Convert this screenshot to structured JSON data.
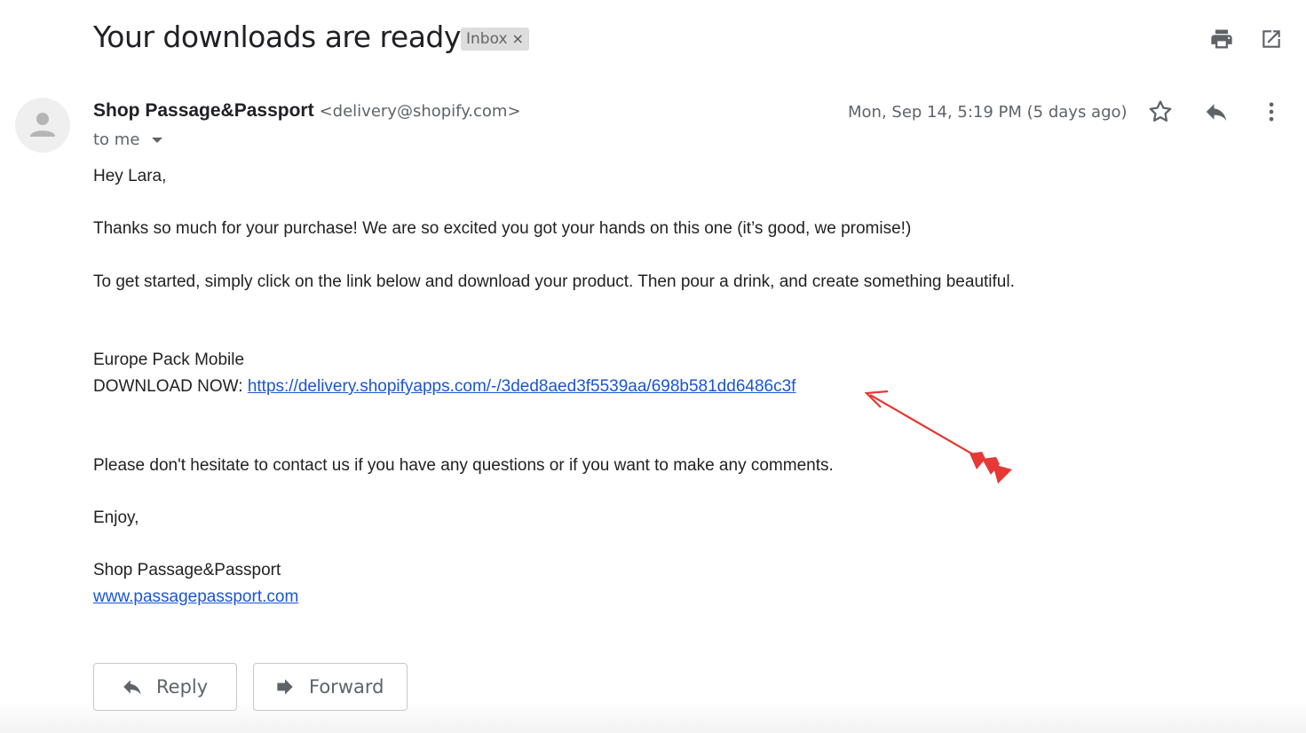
{
  "email": {
    "subject": "Your downloads are ready",
    "label": "Inbox",
    "label_close": "×",
    "sender_name": "Shop Passage&Passport",
    "sender_email": "<delivery@shopify.com>",
    "recipient": "to me",
    "date": "Mon, Sep 14, 5:19 PM (5 days ago)"
  },
  "body": {
    "greeting": "Hey Lara,",
    "para1": "Thanks so much for your purchase! We are so excited you got your hands on this one (it’s good, we promise!)",
    "para2": "To get started, simply click on the link below and download your product. Then pour a drink, and create something beautiful.",
    "product_name": "Europe Pack Mobile",
    "download_label": "DOWNLOAD NOW:",
    "download_link": "https://delivery.shopifyapps.com/-/3ded8aed3f5539aa/698b581dd6486c3f",
    "para3": "Please don't hesitate to contact us if you have any questions or if you want to make any comments.",
    "signoff": "Enjoy,",
    "signature_name": "Shop Passage&Passport",
    "signature_link": "www.passagepassport.com"
  },
  "actions": {
    "reply_label": "Reply",
    "forward_label": "Forward"
  },
  "icons": {
    "print": "print-icon",
    "open_new_window": "open-in-new-window-icon",
    "star": "star-icon",
    "reply": "reply-icon",
    "more": "more-vertical-icon",
    "forward": "forward-icon",
    "annotation": "red-arrow-annotation"
  },
  "colors": {
    "link": "#1a55d6",
    "annotation_arrow": "#e53935",
    "label_chip": "#dddddd"
  }
}
